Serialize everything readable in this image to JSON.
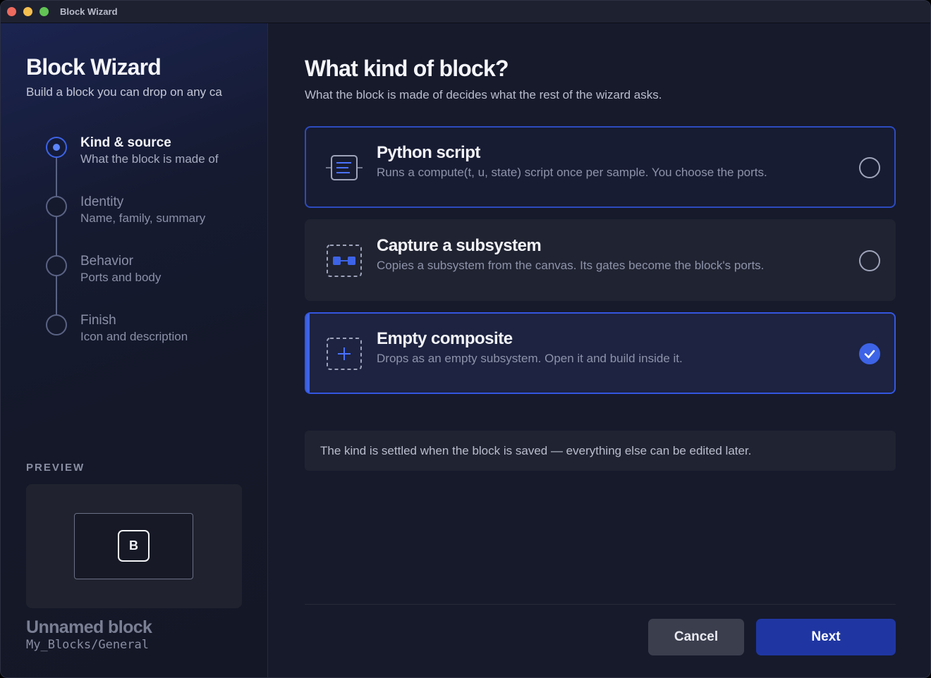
{
  "window": {
    "title": "Block Wizard"
  },
  "sidebar": {
    "title": "Block Wizard",
    "subtitle": "Build a block you can drop on any ca",
    "steps": [
      {
        "name": "Kind & source",
        "desc": "What the block is made of",
        "state": "active"
      },
      {
        "name": "Identity",
        "desc": "Name, family, summary",
        "state": "pending"
      },
      {
        "name": "Behavior",
        "desc": "Ports and body",
        "state": "pending"
      },
      {
        "name": "Finish",
        "desc": "Icon and description",
        "state": "pending"
      }
    ],
    "preview_label": "PREVIEW",
    "preview_glyph": "B",
    "block_name": "Unnamed block",
    "block_path": "My_Blocks/General"
  },
  "main": {
    "title": "What kind of block?",
    "subtitle": "What the block is made of decides what the rest of the wizard asks.",
    "options": [
      {
        "title": "Python script",
        "desc": "Runs a compute(t, u, state) script once per sample. You choose the ports.",
        "icon": "script-icon",
        "selected": false
      },
      {
        "title": "Capture a subsystem",
        "desc": "Copies a subsystem from the canvas. Its gates become the block's ports.",
        "icon": "subsystem-icon",
        "selected": false
      },
      {
        "title": "Empty composite",
        "desc": "Drops as an empty subsystem. Open it and build inside it.",
        "icon": "empty-composite-icon",
        "selected": true
      }
    ],
    "note": "The kind is settled when the block is saved — everything else can be edited later.",
    "buttons": {
      "cancel": "Cancel",
      "next": "Next"
    }
  },
  "colors": {
    "accent": "#3d63e6",
    "window_bg": "#161a2b",
    "card_bg": "#202331",
    "primary_button": "#1f36a2"
  }
}
